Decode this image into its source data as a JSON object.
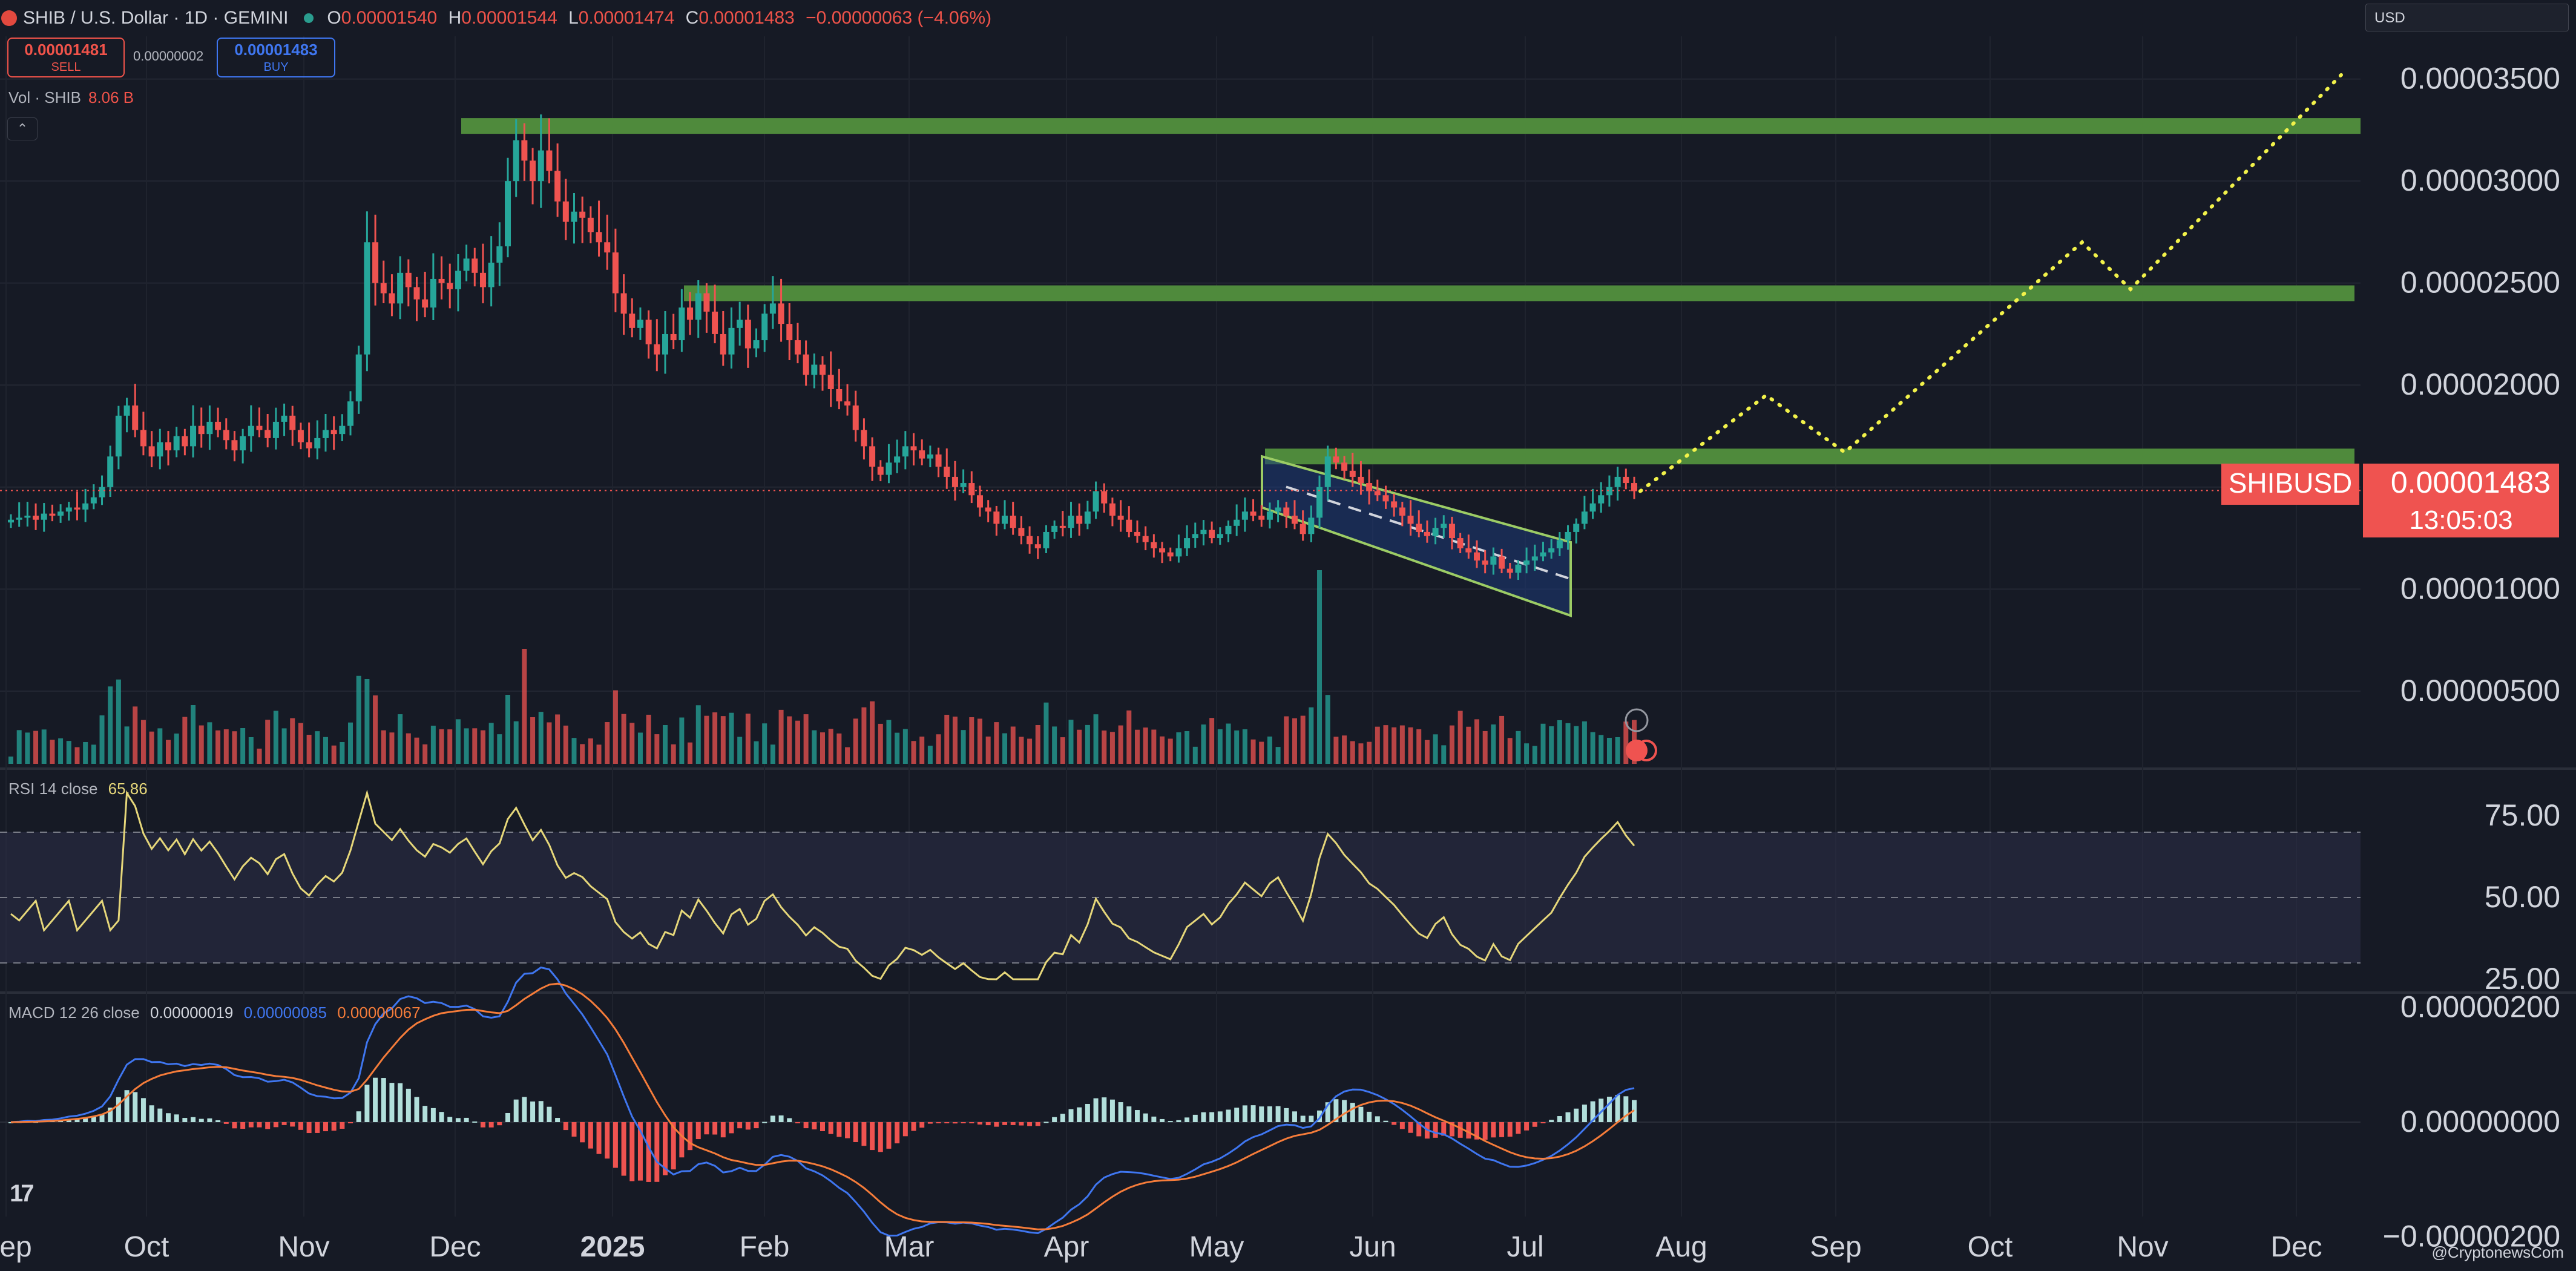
{
  "header": {
    "symbol_title": "SHIB / U.S. Dollar · 1D · GEMINI",
    "ohlc": [
      {
        "k": "O",
        "v": "0.00001540"
      },
      {
        "k": "H",
        "v": "0.00001544"
      },
      {
        "k": "L",
        "v": "0.00001474"
      },
      {
        "k": "C",
        "v": "0.00001483"
      }
    ],
    "change": "−0.00000063 (−4.06%)"
  },
  "trade": {
    "sell_price": "0.00001481",
    "sell_label": "SELL",
    "spread": "0.00000002",
    "buy_price": "0.00001483",
    "buy_label": "BUY"
  },
  "volume_legend": {
    "label": "Vol · SHIB",
    "value": "8.06 B"
  },
  "currency_select": "USD",
  "price_tag": {
    "symbol": "SHIBUSD",
    "price": "0.00001483",
    "countdown": "13:05:03"
  },
  "rsi_legend": {
    "label": "RSI 14 close",
    "value": "65.86"
  },
  "macd_legend": {
    "label": "MACD 12 26 close",
    "macd": "0.00000019",
    "signal": "0.00000085",
    "hist": "0.00000067"
  },
  "watermark": "@CryptonewsCom",
  "colors": {
    "bg": "#161a25",
    "up": "#26a69a",
    "down": "#ef5350",
    "zone": "#4f8a3c",
    "dotted": "#f2f24a",
    "rsi": "#e6d77a",
    "macd": "#3f76f0",
    "signal": "#f57c3a"
  },
  "chart_data": [
    {
      "type": "candlestick",
      "title": "SHIB / U.S. Dollar · 1D · GEMINI",
      "x_labels": [
        "Sep",
        "Oct",
        "Nov",
        "Dec",
        "2025",
        "Feb",
        "Mar",
        "Apr",
        "May",
        "Jun",
        "Jul",
        "Aug",
        "Sep",
        "Oct",
        "Nov",
        "Dec"
      ],
      "y_ticks": [
        "0.00000500",
        "0.00001000",
        "0.00001500",
        "0.00002000",
        "0.00002500",
        "0.00003000",
        "0.00003500"
      ],
      "ylim": [
        1.2e-06,
        3.65e-05
      ],
      "series": [
        {
          "name": "SHIBUSD",
          "close": [
            1.34e-05,
            1.35e-05,
            1.36e-05,
            1.34e-05,
            1.37e-05,
            1.36e-05,
            1.38e-05,
            1.4e-05,
            1.39e-05,
            1.42e-05,
            1.45e-05,
            1.5e-05,
            1.65e-05,
            1.85e-05,
            1.9e-05,
            1.78e-05,
            1.7e-05,
            1.65e-05,
            1.72e-05,
            1.68e-05,
            1.75e-05,
            1.7e-05,
            1.8e-05,
            1.76e-05,
            1.82e-05,
            1.78e-05,
            1.73e-05,
            1.68e-05,
            1.75e-05,
            1.8e-05,
            1.78e-05,
            1.74e-05,
            1.82e-05,
            1.85e-05,
            1.78e-05,
            1.72e-05,
            1.69e-05,
            1.74e-05,
            1.78e-05,
            1.76e-05,
            1.8e-05,
            1.92e-05,
            2.15e-05,
            2.7e-05,
            2.5e-05,
            2.45e-05,
            2.4e-05,
            2.55e-05,
            2.48e-05,
            2.42e-05,
            2.38e-05,
            2.52e-05,
            2.5e-05,
            2.47e-05,
            2.56e-05,
            2.62e-05,
            2.55e-05,
            2.48e-05,
            2.6e-05,
            2.68e-05,
            3e-05,
            3.2e-05,
            3.1e-05,
            3e-05,
            3.15e-05,
            3.05e-05,
            2.9e-05,
            2.8e-05,
            2.85e-05,
            2.82e-05,
            2.75e-05,
            2.7e-05,
            2.65e-05,
            2.45e-05,
            2.35e-05,
            2.28e-05,
            2.32e-05,
            2.2e-05,
            2.15e-05,
            2.25e-05,
            2.22e-05,
            2.38e-05,
            2.32e-05,
            2.45e-05,
            2.36e-05,
            2.25e-05,
            2.15e-05,
            2.28e-05,
            2.32e-05,
            2.18e-05,
            2.22e-05,
            2.35e-05,
            2.4e-05,
            2.3e-05,
            2.22e-05,
            2.15e-05,
            2.05e-05,
            2.1e-05,
            2.05e-05,
            1.98e-05,
            1.92e-05,
            1.9e-05,
            1.78e-05,
            1.7e-05,
            1.6e-05,
            1.56e-05,
            1.62e-05,
            1.65e-05,
            1.7e-05,
            1.68e-05,
            1.64e-05,
            1.66e-05,
            1.6e-05,
            1.55e-05,
            1.5e-05,
            1.52e-05,
            1.46e-05,
            1.4e-05,
            1.38e-05,
            1.32e-05,
            1.36e-05,
            1.3e-05,
            1.26e-05,
            1.22e-05,
            1.2e-05,
            1.28e-05,
            1.31e-05,
            1.3e-05,
            1.36e-05,
            1.32e-05,
            1.38e-05,
            1.48e-05,
            1.42e-05,
            1.36e-05,
            1.34e-05,
            1.28e-05,
            1.26e-05,
            1.23e-05,
            1.2e-05,
            1.18e-05,
            1.16e-05,
            1.2e-05,
            1.25e-05,
            1.27e-05,
            1.29e-05,
            1.25e-05,
            1.27e-05,
            1.31e-05,
            1.34e-05,
            1.38e-05,
            1.36e-05,
            1.34e-05,
            1.38e-05,
            1.4e-05,
            1.36e-05,
            1.32e-05,
            1.27e-05,
            1.35e-05,
            1.5e-05,
            1.65e-05,
            1.62e-05,
            1.58e-05,
            1.55e-05,
            1.52e-05,
            1.48e-05,
            1.46e-05,
            1.43e-05,
            1.4e-05,
            1.36e-05,
            1.32e-05,
            1.28e-05,
            1.26e-05,
            1.3e-05,
            1.32e-05,
            1.25e-05,
            1.2e-05,
            1.18e-05,
            1.14e-05,
            1.12e-05,
            1.16e-05,
            1.1e-05,
            1.08e-05,
            1.12e-05,
            1.14e-05,
            1.16e-05,
            1.18e-05,
            1.2e-05,
            1.24e-05,
            1.28e-05,
            1.32e-05,
            1.38e-05,
            1.42e-05,
            1.46e-05,
            1.5e-05,
            1.55e-05,
            1.52e-05,
            1.48e-05
          ]
        }
      ],
      "resistance_zones": [
        3.27e-05,
        2.45e-05,
        1.65e-05
      ],
      "falling_channel": {
        "upper_start": 1.65e-05,
        "upper_end": 1.23e-05,
        "lower_start": 1.4e-05,
        "lower_end": 8.7e-06
      },
      "projection_path": [
        1.48e-05,
        1.95e-05,
        1.67e-05,
        2.7e-05,
        2.47e-05,
        3.52e-05
      ],
      "last_price": 1.483e-05
    },
    {
      "type": "line",
      "name": "RSI 14 close",
      "y_ticks": [
        "25.00",
        "50.00",
        "75.00"
      ],
      "levels": [
        70,
        50,
        30
      ],
      "last_value": 65.86
    },
    {
      "type": "bar",
      "name": "MACD 12 26 close",
      "y_ticks": [
        "−0.00000200",
        "0.00000000",
        "0.00000200"
      ],
      "macd_last": 1.9e-07,
      "signal_last": 8.5e-07,
      "hist_last": 6.7e-07
    }
  ]
}
